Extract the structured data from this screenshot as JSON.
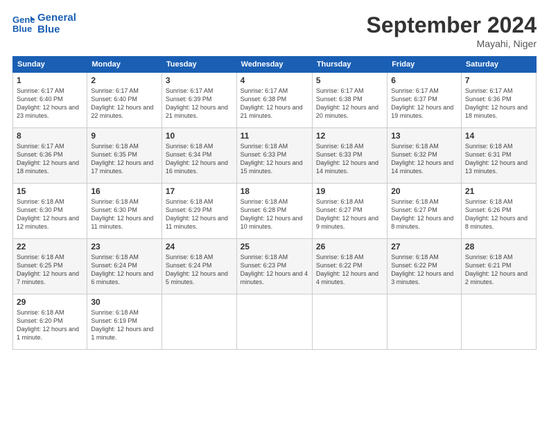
{
  "header": {
    "logo_line1": "General",
    "logo_line2": "Blue",
    "month_title": "September 2024",
    "location": "Mayahi, Niger"
  },
  "days_of_week": [
    "Sunday",
    "Monday",
    "Tuesday",
    "Wednesday",
    "Thursday",
    "Friday",
    "Saturday"
  ],
  "weeks": [
    [
      {
        "day": "1",
        "sunrise": "6:17 AM",
        "sunset": "6:40 PM",
        "daylight": "12 hours and 23 minutes."
      },
      {
        "day": "2",
        "sunrise": "6:17 AM",
        "sunset": "6:40 PM",
        "daylight": "12 hours and 22 minutes."
      },
      {
        "day": "3",
        "sunrise": "6:17 AM",
        "sunset": "6:39 PM",
        "daylight": "12 hours and 21 minutes."
      },
      {
        "day": "4",
        "sunrise": "6:17 AM",
        "sunset": "6:38 PM",
        "daylight": "12 hours and 21 minutes."
      },
      {
        "day": "5",
        "sunrise": "6:17 AM",
        "sunset": "6:38 PM",
        "daylight": "12 hours and 20 minutes."
      },
      {
        "day": "6",
        "sunrise": "6:17 AM",
        "sunset": "6:37 PM",
        "daylight": "12 hours and 19 minutes."
      },
      {
        "day": "7",
        "sunrise": "6:17 AM",
        "sunset": "6:36 PM",
        "daylight": "12 hours and 18 minutes."
      }
    ],
    [
      {
        "day": "8",
        "sunrise": "6:17 AM",
        "sunset": "6:36 PM",
        "daylight": "12 hours and 18 minutes."
      },
      {
        "day": "9",
        "sunrise": "6:18 AM",
        "sunset": "6:35 PM",
        "daylight": "12 hours and 17 minutes."
      },
      {
        "day": "10",
        "sunrise": "6:18 AM",
        "sunset": "6:34 PM",
        "daylight": "12 hours and 16 minutes."
      },
      {
        "day": "11",
        "sunrise": "6:18 AM",
        "sunset": "6:33 PM",
        "daylight": "12 hours and 15 minutes."
      },
      {
        "day": "12",
        "sunrise": "6:18 AM",
        "sunset": "6:33 PM",
        "daylight": "12 hours and 14 minutes."
      },
      {
        "day": "13",
        "sunrise": "6:18 AM",
        "sunset": "6:32 PM",
        "daylight": "12 hours and 14 minutes."
      },
      {
        "day": "14",
        "sunrise": "6:18 AM",
        "sunset": "6:31 PM",
        "daylight": "12 hours and 13 minutes."
      }
    ],
    [
      {
        "day": "15",
        "sunrise": "6:18 AM",
        "sunset": "6:30 PM",
        "daylight": "12 hours and 12 minutes."
      },
      {
        "day": "16",
        "sunrise": "6:18 AM",
        "sunset": "6:30 PM",
        "daylight": "12 hours and 11 minutes."
      },
      {
        "day": "17",
        "sunrise": "6:18 AM",
        "sunset": "6:29 PM",
        "daylight": "12 hours and 11 minutes."
      },
      {
        "day": "18",
        "sunrise": "6:18 AM",
        "sunset": "6:28 PM",
        "daylight": "12 hours and 10 minutes."
      },
      {
        "day": "19",
        "sunrise": "6:18 AM",
        "sunset": "6:27 PM",
        "daylight": "12 hours and 9 minutes."
      },
      {
        "day": "20",
        "sunrise": "6:18 AM",
        "sunset": "6:27 PM",
        "daylight": "12 hours and 8 minutes."
      },
      {
        "day": "21",
        "sunrise": "6:18 AM",
        "sunset": "6:26 PM",
        "daylight": "12 hours and 8 minutes."
      }
    ],
    [
      {
        "day": "22",
        "sunrise": "6:18 AM",
        "sunset": "6:25 PM",
        "daylight": "12 hours and 7 minutes."
      },
      {
        "day": "23",
        "sunrise": "6:18 AM",
        "sunset": "6:24 PM",
        "daylight": "12 hours and 6 minutes."
      },
      {
        "day": "24",
        "sunrise": "6:18 AM",
        "sunset": "6:24 PM",
        "daylight": "12 hours and 5 minutes."
      },
      {
        "day": "25",
        "sunrise": "6:18 AM",
        "sunset": "6:23 PM",
        "daylight": "12 hours and 4 minutes."
      },
      {
        "day": "26",
        "sunrise": "6:18 AM",
        "sunset": "6:22 PM",
        "daylight": "12 hours and 4 minutes."
      },
      {
        "day": "27",
        "sunrise": "6:18 AM",
        "sunset": "6:22 PM",
        "daylight": "12 hours and 3 minutes."
      },
      {
        "day": "28",
        "sunrise": "6:18 AM",
        "sunset": "6:21 PM",
        "daylight": "12 hours and 2 minutes."
      }
    ],
    [
      {
        "day": "29",
        "sunrise": "6:18 AM",
        "sunset": "6:20 PM",
        "daylight": "12 hours and 1 minute."
      },
      {
        "day": "30",
        "sunrise": "6:18 AM",
        "sunset": "6:19 PM",
        "daylight": "12 hours and 1 minute."
      },
      null,
      null,
      null,
      null,
      null
    ]
  ]
}
